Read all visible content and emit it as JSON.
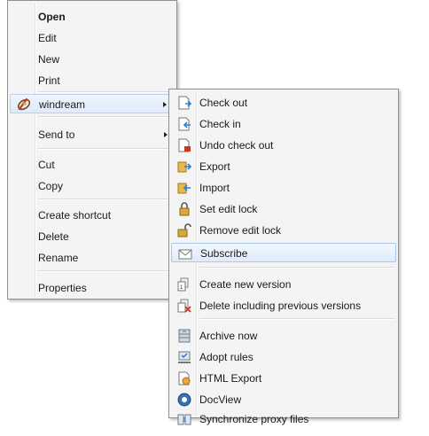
{
  "main_menu": {
    "items": [
      {
        "label": "Open"
      },
      {
        "label": "Edit"
      },
      {
        "label": "New"
      },
      {
        "label": "Print"
      },
      {
        "label": "windream",
        "icon": "windream-logo-icon"
      },
      {
        "label": "Send to"
      },
      {
        "label": "Cut"
      },
      {
        "label": "Copy"
      },
      {
        "label": "Create shortcut"
      },
      {
        "label": "Delete"
      },
      {
        "label": "Rename"
      },
      {
        "label": "Properties"
      }
    ]
  },
  "sub_menu": {
    "items": [
      {
        "label": "Check out",
        "icon": "check-out-icon"
      },
      {
        "label": "Check in",
        "icon": "check-in-icon"
      },
      {
        "label": "Undo check out",
        "icon": "undo-check-out-icon"
      },
      {
        "label": "Export",
        "icon": "export-icon"
      },
      {
        "label": "Import",
        "icon": "import-icon"
      },
      {
        "label": "Set edit lock",
        "icon": "lock-icon"
      },
      {
        "label": "Remove edit lock",
        "icon": "unlock-icon"
      },
      {
        "label": "Subscribe",
        "icon": "envelope-icon"
      },
      {
        "label": "Create new version",
        "icon": "new-version-icon"
      },
      {
        "label": "Delete including previous versions",
        "icon": "delete-versions-icon"
      },
      {
        "label": "Archive now",
        "icon": "archive-icon"
      },
      {
        "label": "Adopt rules",
        "icon": "adopt-rules-icon"
      },
      {
        "label": "HTML Export",
        "icon": "html-export-icon"
      },
      {
        "label": "DocView",
        "icon": "docview-icon"
      },
      {
        "label": "Synchronize proxy files",
        "icon": "sync-proxy-icon"
      }
    ]
  },
  "colors": {
    "menu_bg": "#f4f4f4",
    "highlight_border": "#a8c8f0",
    "highlight_bg": "#e0ecfc"
  }
}
